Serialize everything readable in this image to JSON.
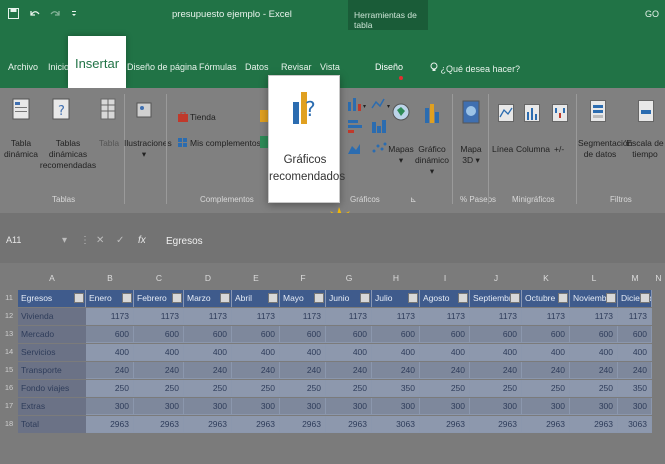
{
  "titlebar": {
    "qat_icons": [
      "save-icon",
      "undo-icon",
      "redo-icon",
      "customize-icon"
    ],
    "title": "presupuesto ejemplo  -  Excel",
    "context_group": "Herramientas de tabla",
    "account": "GO"
  },
  "tabs": [
    "Archivo",
    "Inicio",
    "Insertar",
    "Diseño de página",
    "Fórmulas",
    "Datos",
    "Revisar",
    "Vista",
    "Diseño"
  ],
  "tell_me": "¿Qué desea hacer?",
  "ribbon": {
    "tablas": {
      "label": "Tablas",
      "tabla_dinamica": [
        "Tabla",
        "dinámica"
      ],
      "tablas_recomendadas": [
        "Tablas dinámicas",
        "recomendadas"
      ],
      "tabla": "Tabla"
    },
    "ilustraciones": "Ilustraciones",
    "complementos": {
      "label": "Complementos",
      "tienda": "Tienda",
      "mis_complementos": "Mis complementos"
    },
    "graficos_recomendados": [
      "Gráficos",
      "recomendados"
    ],
    "graficos": {
      "label": "Gráficos",
      "mapas": "Mapas",
      "grafico_dinamico": [
        "Gráfico",
        "dinámico"
      ]
    },
    "paseos": {
      "label": "Paseos",
      "mapa3d": [
        "Mapa",
        "3D"
      ]
    },
    "minigraficos": {
      "label": "Minigráficos",
      "linea": "Línea",
      "columna": "Columna",
      "ganancia": "+/-"
    },
    "filtros": {
      "label": "Filtros",
      "segmentacion": [
        "Segmentación",
        "de datos"
      ],
      "escala": [
        "Escala de",
        "tiempo"
      ]
    }
  },
  "formula_bar": {
    "name_box": "A11",
    "content": "Egresos"
  },
  "columns": [
    "A",
    "B",
    "C",
    "D",
    "E",
    "F",
    "G",
    "H",
    "I",
    "J",
    "K",
    "L",
    "M",
    "N"
  ],
  "row_numbers": [
    "11",
    "12",
    "13",
    "14",
    "15",
    "16",
    "17",
    "18"
  ],
  "table": {
    "headers": [
      "Egresos",
      "Enero",
      "Febrero",
      "Marzo",
      "Abril",
      "Mayo",
      "Junio",
      "Julio",
      "Agosto",
      "Septiembre",
      "Octubre",
      "Noviembre",
      "Diciembre"
    ],
    "rows": [
      {
        "label": "Vivienda",
        "values": [
          "1173",
          "1173",
          "1173",
          "1173",
          "1173",
          "1173",
          "1173",
          "1173",
          "1173",
          "1173",
          "1173",
          "1173"
        ]
      },
      {
        "label": "Mercado",
        "values": [
          "600",
          "600",
          "600",
          "600",
          "600",
          "600",
          "600",
          "600",
          "600",
          "600",
          "600",
          "600"
        ]
      },
      {
        "label": "Servicios",
        "values": [
          "400",
          "400",
          "400",
          "400",
          "400",
          "400",
          "400",
          "400",
          "400",
          "400",
          "400",
          "400"
        ]
      },
      {
        "label": "Transporte",
        "values": [
          "240",
          "240",
          "240",
          "240",
          "240",
          "240",
          "240",
          "240",
          "240",
          "240",
          "240",
          "240"
        ]
      },
      {
        "label": "Fondo viajes",
        "values": [
          "250",
          "250",
          "250",
          "250",
          "250",
          "250",
          "350",
          "250",
          "250",
          "250",
          "250",
          "350"
        ]
      },
      {
        "label": "Extras",
        "values": [
          "300",
          "300",
          "300",
          "300",
          "300",
          "300",
          "300",
          "300",
          "300",
          "300",
          "300",
          "300"
        ]
      },
      {
        "label": "Total",
        "values": [
          "2963",
          "2963",
          "2963",
          "2963",
          "2963",
          "2963",
          "3063",
          "2963",
          "2963",
          "2963",
          "2963",
          "3063"
        ]
      }
    ]
  }
}
